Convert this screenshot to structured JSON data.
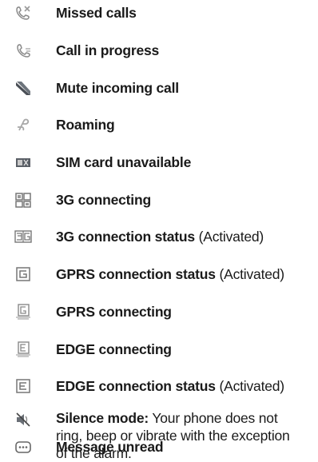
{
  "icons": [
    {
      "label": "Missed calls",
      "icon": "missed-calls-icon"
    },
    {
      "label": "Call in progress",
      "icon": "call-in-progress-icon"
    },
    {
      "label": "Mute incoming call",
      "icon": "mute-incoming-call-icon"
    },
    {
      "label": "Roaming",
      "icon": "roaming-icon"
    },
    {
      "label": "SIM card unavailable",
      "icon": "sim-unavailable-icon"
    },
    {
      "label": "3G connecting",
      "icon": "3g-connecting-icon"
    },
    {
      "label": "3G connection status",
      "suffix": "(Activated)",
      "icon": "3g-status-icon"
    },
    {
      "label": "GPRS connection status",
      "suffix": "(Activated)",
      "icon": "gprs-status-icon"
    },
    {
      "label": "GPRS connecting",
      "icon": "gprs-connecting-icon"
    },
    {
      "label": "EDGE connecting",
      "icon": "edge-connecting-icon"
    },
    {
      "label": "EDGE connection status",
      "suffix": "(Activated)",
      "icon": "edge-status-icon"
    },
    {
      "label": "Silence mode:",
      "description_lines": [
        "Your phone does not",
        "ring, beep or vibrate with the exception",
        "of the alarm."
      ],
      "icon": "silence-mode-icon"
    },
    {
      "label": "Message unread",
      "icon": "message-unread-icon"
    }
  ]
}
